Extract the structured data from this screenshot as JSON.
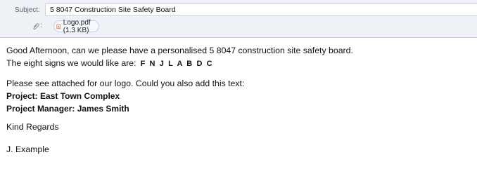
{
  "header": {
    "subject_label": "Subject:",
    "subject_value": "5 8047 Construction Site Safety Board",
    "attachment_label": ":",
    "attachment": {
      "icon": "pdf-icon",
      "filename": "Logo.pdf (1.3 KB)"
    }
  },
  "message": {
    "line1": "Good Afternoon, can we please have a personalised 5 8047 construction site safety board.",
    "line2_prefix": "The eight signs we would like are:",
    "line2_codes": "F N J L A B D C",
    "line3": "Please see attached for our logo. Could you also add this text:",
    "project": "Project: East Town Complex",
    "manager": "Project Manager: James Smith",
    "regards": "Kind Regards",
    "signature": "J. Example"
  },
  "colors": {
    "header_bg": "#eef1f5",
    "pill_border": "#c7d3e3",
    "pdf_red": "#d8322b"
  }
}
